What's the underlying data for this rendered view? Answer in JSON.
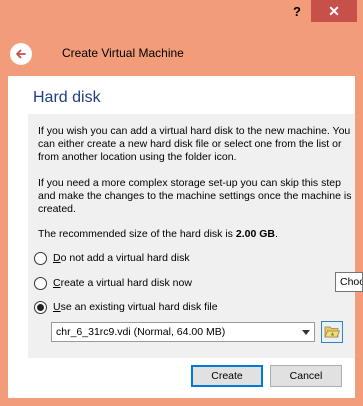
{
  "titlebar": {
    "help_label": "?",
    "close_label": "✕"
  },
  "wizard": {
    "title": "Create Virtual Machine",
    "page_heading": "Hard disk"
  },
  "body": {
    "para1": "If you wish you can add a virtual hard disk to the new machine. You can either create a new hard disk file or select one from the list or from another location using the folder icon.",
    "para2": "If you need a more complex storage set-up you can skip this step and make the changes to the machine settings once the machine is created.",
    "para3_prefix": "The recommended size of the hard disk is ",
    "para3_value": "2.00 GB",
    "para3_suffix": "."
  },
  "options": [
    {
      "mnemonic": "D",
      "rest": "o not add a virtual hard disk",
      "checked": false
    },
    {
      "mnemonic": "C",
      "rest": "reate a virtual hard disk now",
      "checked": false
    },
    {
      "mnemonic": "U",
      "rest": "se an existing virtual hard disk file",
      "checked": true
    }
  ],
  "disk_select": {
    "value": "chr_6_31rc9.vdi (Normal, 64.00 MB)"
  },
  "tooltip": {
    "text": "Choose"
  },
  "buttons": {
    "create": "Create",
    "cancel": "Cancel"
  },
  "colors": {
    "title_bar": "#f29c79",
    "close_button": "#c7504a",
    "heading": "#1e3f86"
  },
  "icons": {
    "back": "back-arrow-icon",
    "dropdown": "chevron-down-icon",
    "folder": "folder-open-icon"
  }
}
